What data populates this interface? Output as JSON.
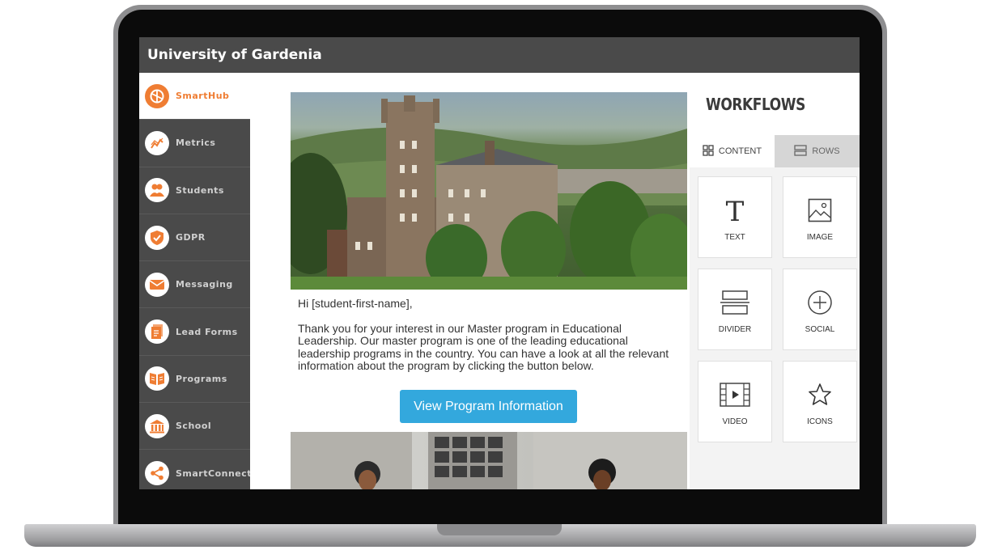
{
  "app": {
    "title": "University of Gardenia"
  },
  "sidebar": {
    "items": [
      {
        "label": "SmartHub",
        "icon": "smarthub-icon",
        "active": true
      },
      {
        "label": "Metrics",
        "icon": "metrics-icon"
      },
      {
        "label": "Students",
        "icon": "students-icon"
      },
      {
        "label": "GDPR",
        "icon": "gdpr-shield-icon"
      },
      {
        "label": "Messaging",
        "icon": "envelope-icon"
      },
      {
        "label": "Lead Forms",
        "icon": "forms-icon"
      },
      {
        "label": "Programs",
        "icon": "book-icon"
      },
      {
        "label": "School",
        "icon": "building-icon"
      },
      {
        "label": "SmartConnect",
        "icon": "share-icon"
      }
    ]
  },
  "email": {
    "greeting": "Hi [student-first-name],",
    "body": "Thank you for your interest in our Master program in Educational Leadership. Our master program is one of the leading educational leadership programs in the country. You can have a look at all the relevant information about the program by clicking the button below.",
    "cta_label": "View Program Information"
  },
  "panel": {
    "title": "WORKFLOWS",
    "tabs": [
      {
        "label": "CONTENT",
        "active": true
      },
      {
        "label": "ROWS",
        "active": false
      }
    ],
    "tiles": [
      {
        "label": "TEXT",
        "icon": "text-icon"
      },
      {
        "label": "IMAGE",
        "icon": "image-icon"
      },
      {
        "label": "DIVIDER",
        "icon": "divider-icon"
      },
      {
        "label": "SOCIAL",
        "icon": "social-plus-icon"
      },
      {
        "label": "VIDEO",
        "icon": "video-icon"
      },
      {
        "label": "ICONS",
        "icon": "star-icon"
      }
    ]
  },
  "colors": {
    "accent": "#ef7d33",
    "topbar": "#4a4a4a",
    "sidebar": "#4a4a4a",
    "button": "#33a8dd"
  }
}
